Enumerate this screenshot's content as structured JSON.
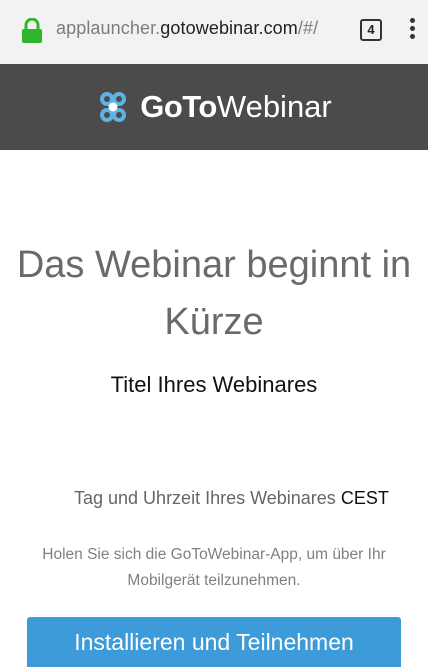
{
  "browser": {
    "url_prefix": "applauncher.",
    "url_host": "gotowebinar.com",
    "url_suffix": "/#/",
    "tab_count": "4",
    "icons": [
      "lock-icon",
      "tabs-icon",
      "overflow-menu-icon"
    ],
    "lock_color": "#2fb52c"
  },
  "header": {
    "brand_bold": "GoTo",
    "brand_light": "Webinar",
    "background": "#4b4b4b",
    "logo_icon": "gotowebinar-logo-icon",
    "logo_color": "#5fb3e4"
  },
  "main": {
    "headline": "Das Webinar beginnt in Kürze",
    "webinar_title": "Titel Ihres Webinares",
    "webinar_time": "Tag und Uhrzeit Ihres Webinares",
    "timezone": "CEST",
    "info_text": "Holen Sie sich die GoToWebinar-App, um über Ihr Mobilgerät teilzunehmen.",
    "cta_label": "Installieren und Teilnehmen",
    "cta_color": "#3d9bd9"
  }
}
